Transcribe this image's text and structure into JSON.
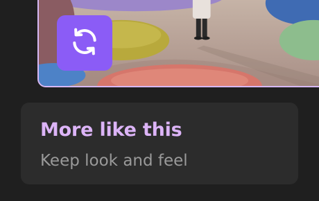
{
  "remix": {
    "icon": "refresh-icon",
    "accent": "#8b5cf6"
  },
  "suggestion": {
    "title": "More like this",
    "subtitle": "Keep look and feel",
    "title_color": "#dcb4f7"
  }
}
